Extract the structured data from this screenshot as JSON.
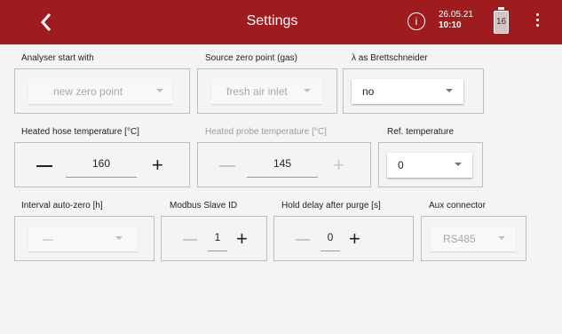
{
  "header": {
    "back_label": "<",
    "title": "Settings",
    "info_label": "i",
    "date": "26.05.21",
    "time": "10:10",
    "battery": "16"
  },
  "colors": {
    "header": "#9e1b1e",
    "background": "#f4f4f4"
  },
  "row1": {
    "analyser_start": {
      "label": "Analyser start with",
      "value": "new zero point"
    },
    "source_zero": {
      "label": "Source zero point (gas)",
      "value": "fresh air inlet"
    },
    "lambda": {
      "label": "λ as Brettschneider",
      "value": "no"
    }
  },
  "row2": {
    "heated_hose": {
      "label": "Heated hose temperature [°C]",
      "value": "160"
    },
    "heated_probe": {
      "label": "Heated probe temperature [°C]",
      "value": "145"
    },
    "ref_temp": {
      "label": "Ref. temperature",
      "value": "0"
    }
  },
  "row3": {
    "interval": {
      "label": "Interval auto-zero [h]",
      "value": "—"
    },
    "modbus": {
      "label": "Modbus Slave ID",
      "value": "1"
    },
    "hold_delay": {
      "label": "Hold delay after purge [s]",
      "value": "0"
    },
    "aux": {
      "label": "Aux connector",
      "value": "RS485"
    }
  }
}
